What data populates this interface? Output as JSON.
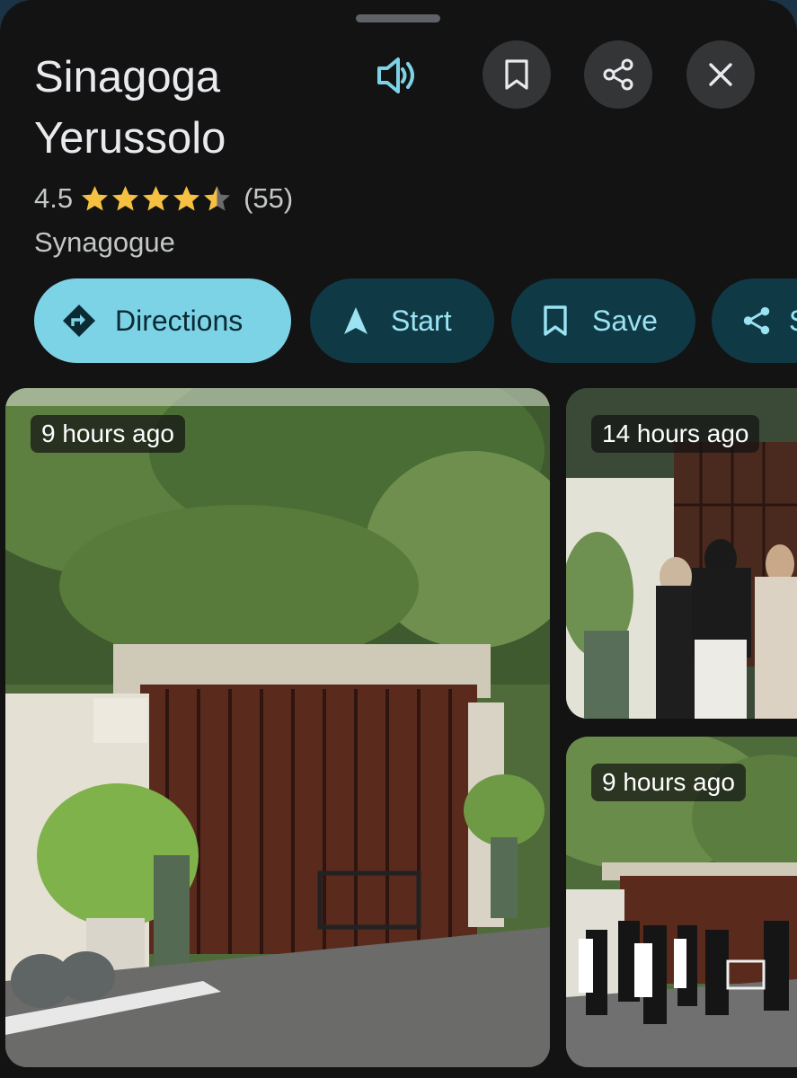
{
  "place": {
    "name": "Sinagoga Yerussolo",
    "rating": "4.5",
    "star_value": 4.5,
    "review_count": "(55)",
    "category": "Synagogue"
  },
  "header_icons": {
    "speak": "volume-icon",
    "save": "bookmark-icon",
    "share": "share-icon",
    "close": "close-icon"
  },
  "actions": [
    {
      "label": "Directions",
      "icon": "directions-icon"
    },
    {
      "label": "Start",
      "icon": "navigation-arrow-icon"
    },
    {
      "label": "Save",
      "icon": "bookmark-icon"
    },
    {
      "label": "Share",
      "icon": "share-icon"
    }
  ],
  "photos": [
    {
      "time": "9 hours ago"
    },
    {
      "time": "14 hours ago"
    },
    {
      "time": "9 hours ago"
    }
  ],
  "colors": {
    "background": "#131314",
    "primary_chip": "#7dd3e6",
    "tonal_chip": "#0f3a45",
    "star": "#f6c042",
    "accent": "#7dd3e6"
  }
}
